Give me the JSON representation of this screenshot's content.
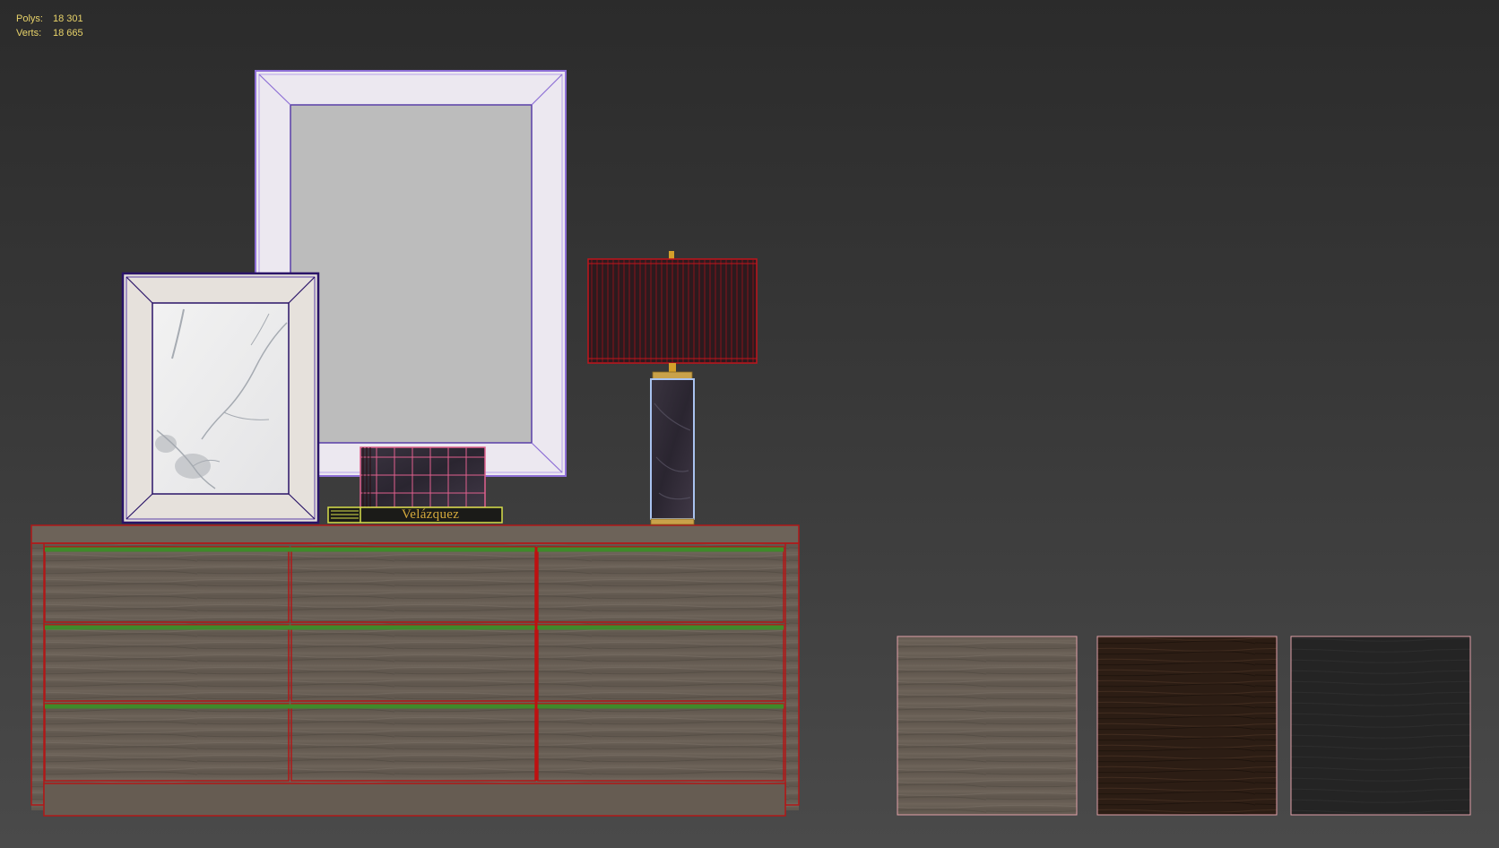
{
  "stats": {
    "polys_label": "Polys:",
    "polys_value": "18 301",
    "verts_label": "Verts:",
    "verts_value": "18 665"
  },
  "scene": {
    "book_title": "Velázquez",
    "colors": {
      "background_top": "#2b2b2b",
      "background_bottom": "#4a4a4a",
      "stats_text": "#e8d36a",
      "dresser_wireframe": "#b01818",
      "drawer_top_edge": "#3f8a2a",
      "large_frame_wireframe": "#8e6fd6",
      "small_frame_wireframe": "#2a1468",
      "lampshade_wireframe": "#c0141c",
      "lamp_base_wireframe": "#a9c3f0",
      "box_wireframe": "#e0608e",
      "book_wireframe": "#d8e04a",
      "swatch_border": "#e0a0a8"
    }
  },
  "swatches": [
    {
      "name": "light-wood-texture",
      "color": "#6a6056"
    },
    {
      "name": "dark-wood-texture",
      "color": "#2c1d14"
    },
    {
      "name": "black-wood-texture",
      "color": "#242424"
    }
  ]
}
